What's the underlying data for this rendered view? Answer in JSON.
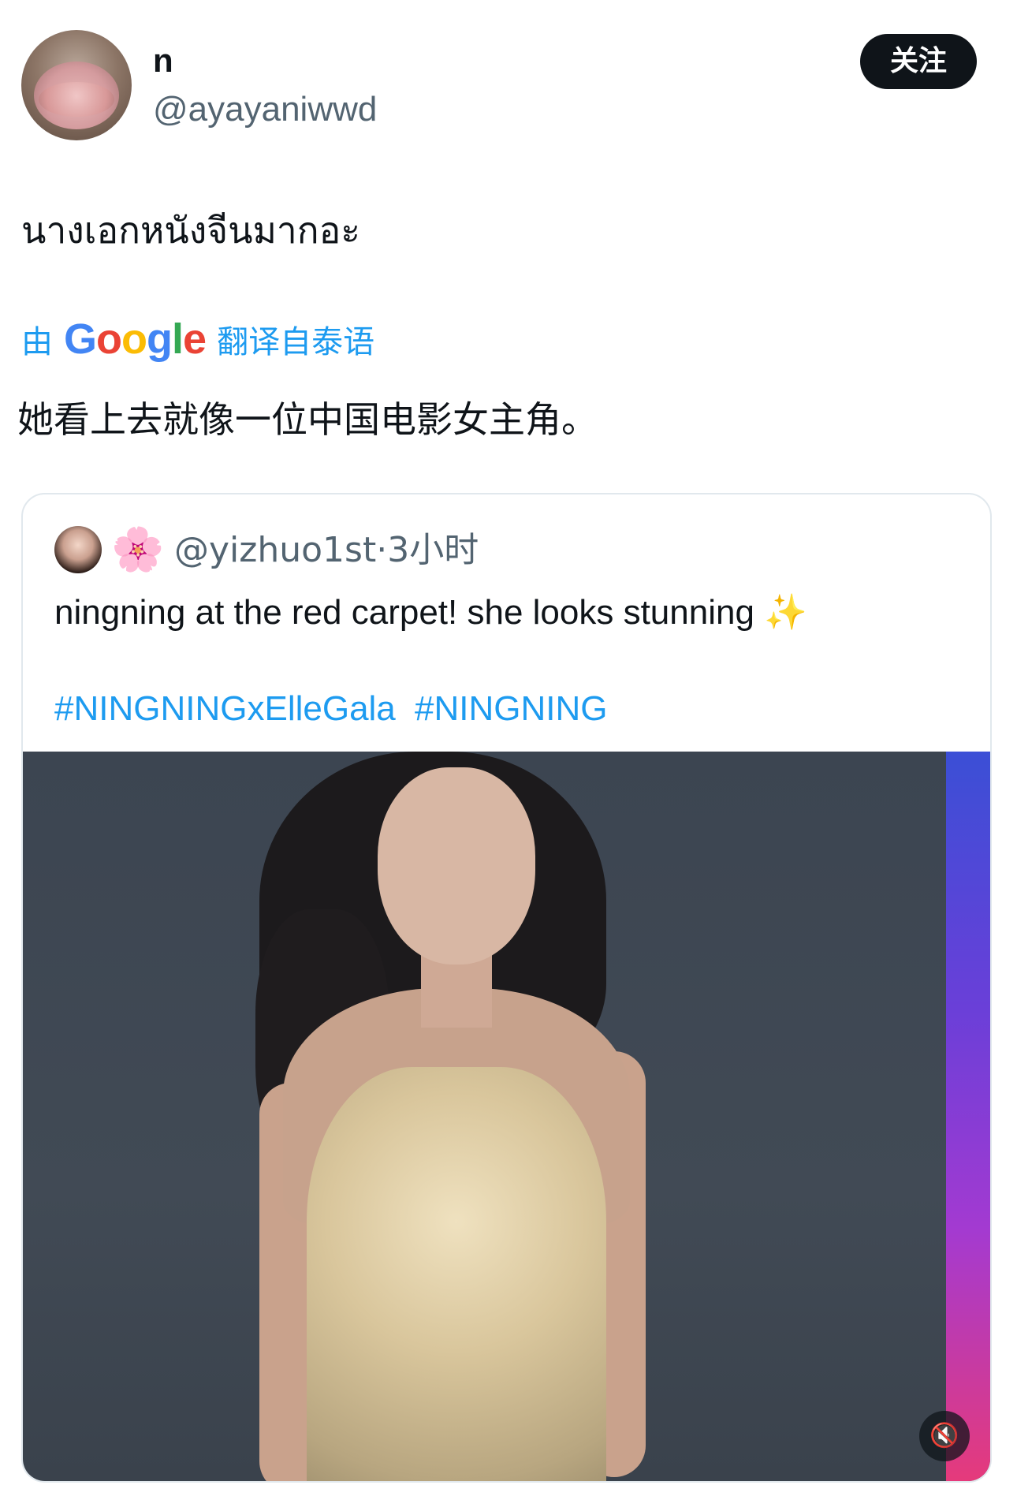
{
  "author": {
    "display_name": "n",
    "handle": "@ayayaniwwd",
    "follow_label": "关注"
  },
  "post": {
    "text": "นางเอกหนังจีนมากอะ",
    "translation": {
      "by_label": "由",
      "google_letters": [
        "G",
        "o",
        "o",
        "g",
        "l",
        "e"
      ],
      "from_label": "翻译自泰语",
      "text": "她看上去就像一位中国电影女主角。"
    }
  },
  "quoted": {
    "emoji": "🌸",
    "meta": "@yizhuo1st·3小时",
    "text": "ningning at the red carpet! she looks stunning",
    "sparkle": "✨",
    "hashtags": [
      "#NINGNINGxElleGala",
      "#NINGNING"
    ],
    "media": {
      "type": "video",
      "description_icon": "mute-icon",
      "mute_glyph": "🔇"
    }
  },
  "colors": {
    "link": "#1d9bf0",
    "secondary_text": "#536471",
    "primary_text": "#0f1419",
    "button_bg": "#0f1419"
  }
}
